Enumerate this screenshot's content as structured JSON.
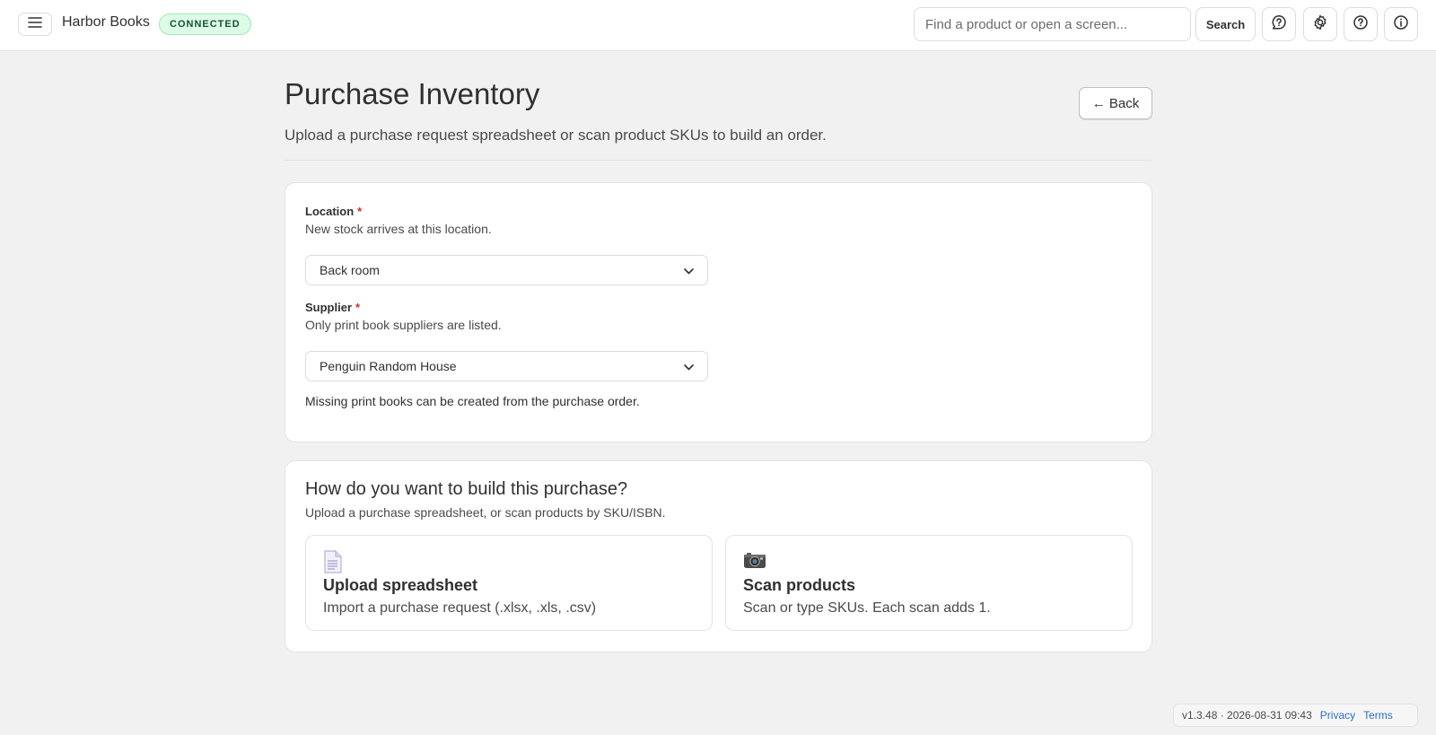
{
  "header": {
    "brand": "Harbor Books",
    "status_badge": "CONNECTED",
    "search_placeholder": "Find a product or open a screen...",
    "search_button": "Search",
    "icons": [
      "menu-icon",
      "feedback-icon",
      "gear-icon",
      "help-icon",
      "info-icon"
    ]
  },
  "page": {
    "title": "Purchase Inventory",
    "back_button": "← Back",
    "subtitle": "Upload a purchase request spreadsheet or scan product SKUs to build an order."
  },
  "form": {
    "location": {
      "label": "Location",
      "required_mark": "*",
      "help": "New stock arrives at this location.",
      "selected": "Back room"
    },
    "supplier": {
      "label": "Supplier",
      "required_mark": "*",
      "help": "Only print book suppliers are listed.",
      "selected": "Penguin Random House"
    },
    "note": "Missing print books can be created from the purchase order."
  },
  "build": {
    "title": "How do you want to build this purchase?",
    "subtitle": "Upload a purchase spreadsheet, or scan products by SKU/ISBN.",
    "options": [
      {
        "icon": "document-icon",
        "title": "Upload spreadsheet",
        "description": "Import a purchase request (.xlsx, .xls, .csv)"
      },
      {
        "icon": "camera-icon",
        "title": "Scan products",
        "description": "Scan or type SKUs. Each scan adds 1."
      }
    ]
  },
  "footer": {
    "version": "v1.3.48 · 2026-08-31 09:43",
    "privacy": "Privacy",
    "terms": "Terms"
  },
  "colors": {
    "background": "#f1f1f1",
    "badge_bg": "#dcfce7",
    "badge_text": "#14532d",
    "required": "#c43232",
    "link": "#2c6ecb"
  }
}
